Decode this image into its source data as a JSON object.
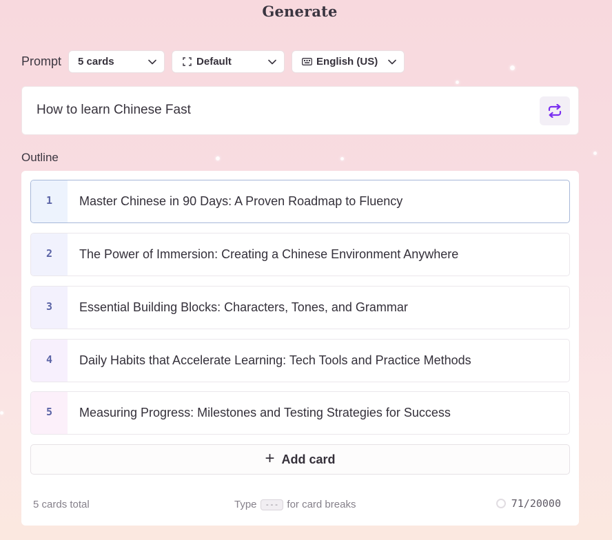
{
  "page": {
    "title": "Generate"
  },
  "prompt_bar": {
    "label": "Prompt",
    "card_count_select": {
      "value": "5 cards"
    },
    "theme_select": {
      "value": "Default",
      "icon": "frame-corners-icon"
    },
    "language_select": {
      "value": "English (US)",
      "icon": "keyboard-icon"
    }
  },
  "prompt": {
    "text": "How to learn Chinese Fast",
    "regenerate_icon": "repeat-arrows-icon"
  },
  "outline": {
    "label": "Outline",
    "cards": [
      {
        "number": "1",
        "title": "Master Chinese in 90 Days: A Proven Roadmap to Fluency",
        "active": true,
        "num_bg": "#edf3fd"
      },
      {
        "number": "2",
        "title": "The Power of Immersion: Creating a Chinese Environment Anywhere",
        "active": false,
        "num_bg": "#f1f2fd"
      },
      {
        "number": "3",
        "title": "Essential Building Blocks: Characters, Tones, and Grammar",
        "active": false,
        "num_bg": "#f3f1fd"
      },
      {
        "number": "4",
        "title": "Daily Habits that Accelerate Learning: Tech Tools and Practice Methods",
        "active": false,
        "num_bg": "#f7f0fd"
      },
      {
        "number": "5",
        "title": "Measuring Progress: Milestones and Testing Strategies for Success",
        "active": false,
        "num_bg": "#fcf0fa"
      }
    ],
    "add_card_label": "Add card"
  },
  "footer": {
    "total": "5 cards total",
    "hint_prefix": "Type",
    "hint_key": "---",
    "hint_suffix": "for card breaks",
    "char_count": "71/20000"
  },
  "colors": {
    "accent": "#7b2ff0",
    "active_border": "#a6b7d8",
    "number_text": "#5b64a6"
  }
}
